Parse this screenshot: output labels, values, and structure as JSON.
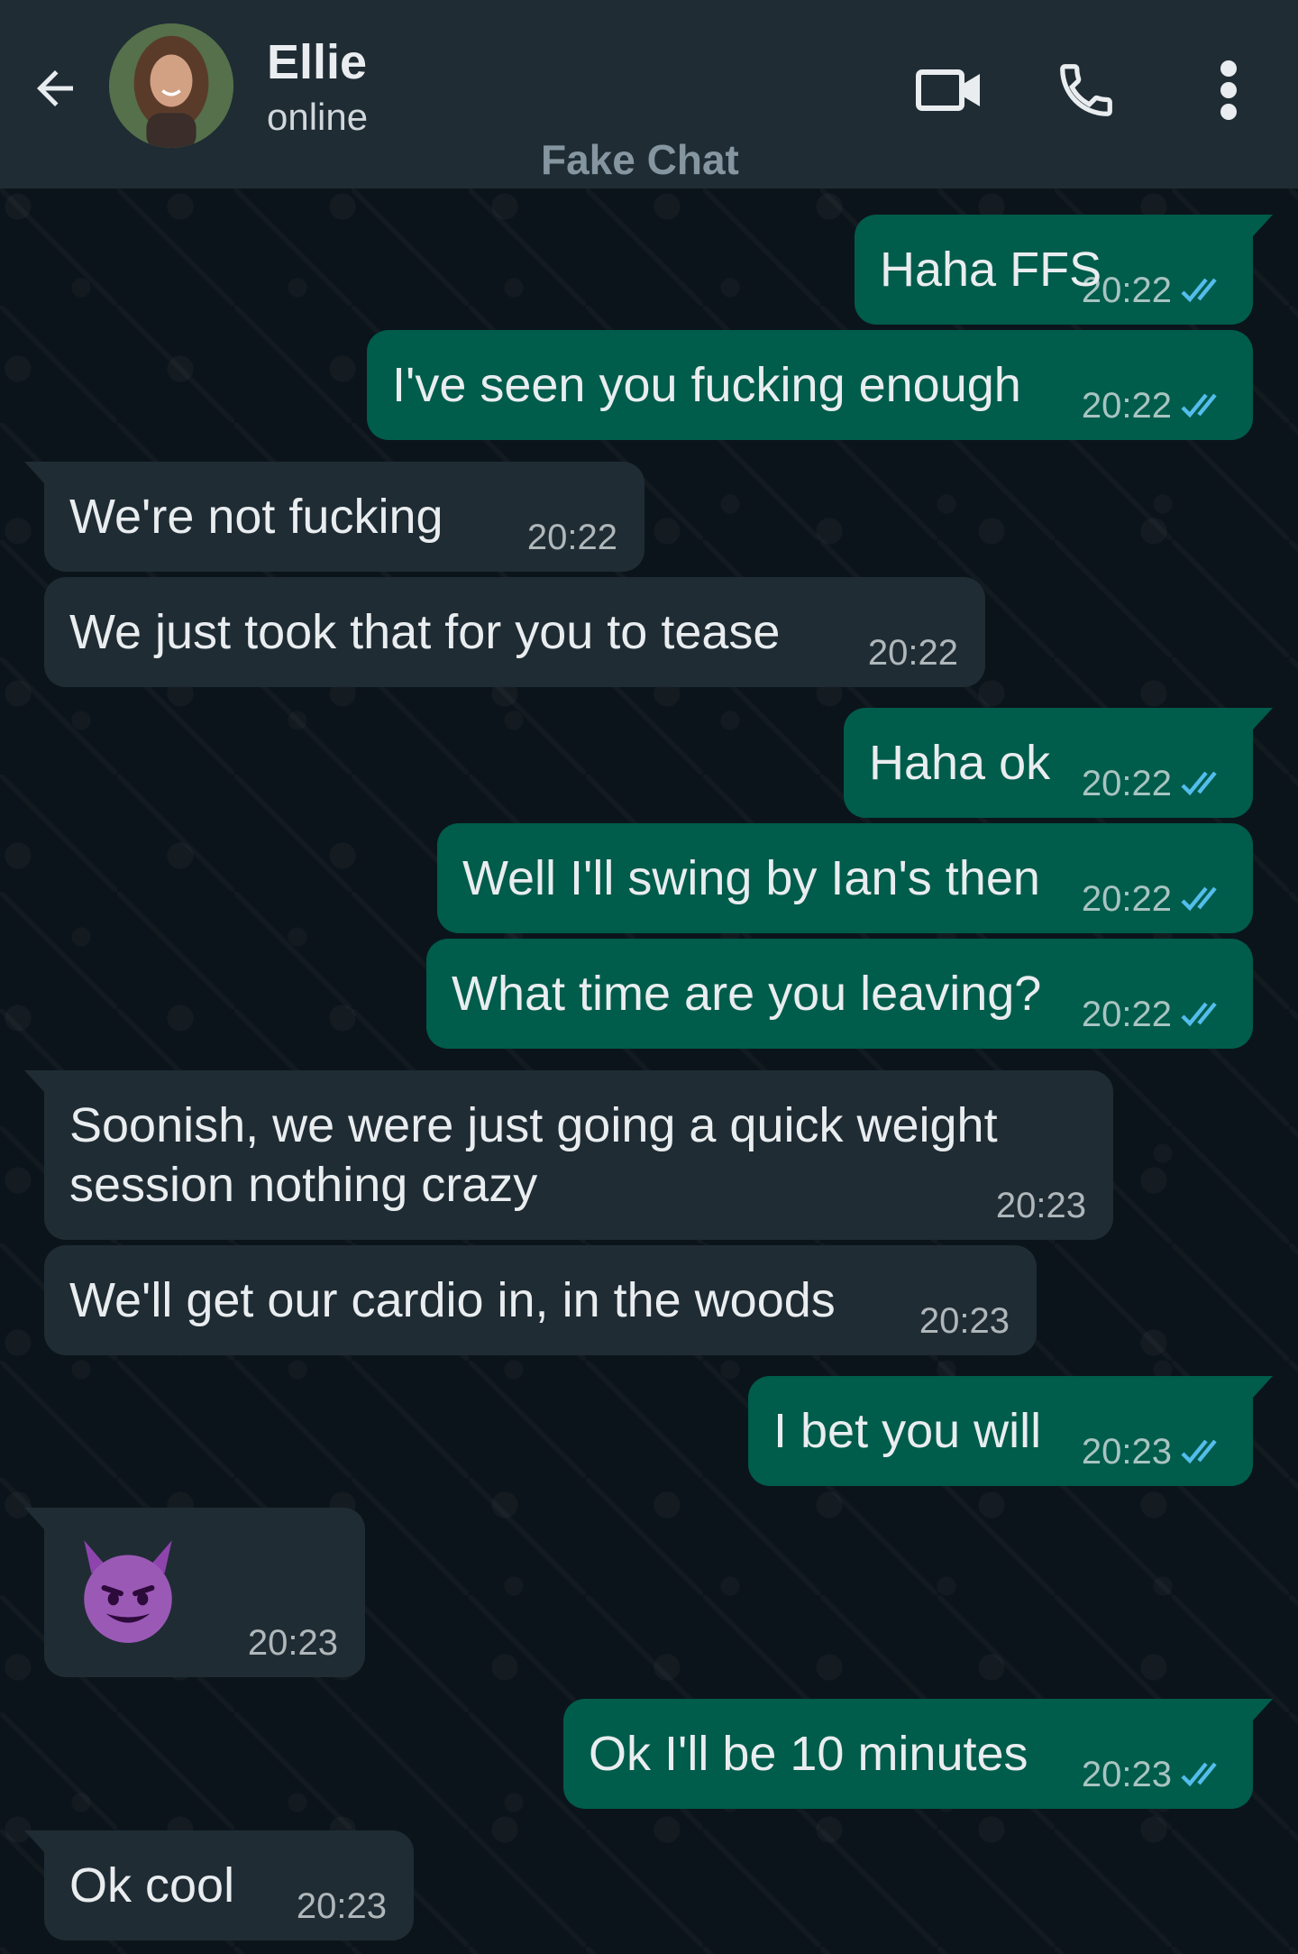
{
  "header": {
    "contact_name": "Ellie",
    "status": "online",
    "watermark": "Fake Chat"
  },
  "icons": {
    "back": "arrow-left-icon",
    "video": "video-camera-icon",
    "call": "phone-icon",
    "menu": "more-vertical-icon",
    "read_receipt": "double-check-icon",
    "emoji": "smiling-imp-emoji"
  },
  "colors": {
    "header_bg": "#1f2c34",
    "chat_bg": "#0b141a",
    "incoming_bubble": "#1f2c34",
    "outgoing_bubble": "#005c4b",
    "read_tick": "#53bdeb"
  },
  "messages": [
    {
      "direction": "out",
      "text": "Haha FFS",
      "time": "20:22",
      "read": true
    },
    {
      "direction": "out",
      "text": "I've seen you fucking enough",
      "time": "20:22",
      "read": true
    },
    {
      "direction": "in",
      "text": "We're not fucking",
      "time": "20:22"
    },
    {
      "direction": "in",
      "text": "We just took that for you to tease",
      "time": "20:22"
    },
    {
      "direction": "out",
      "text": "Haha ok",
      "time": "20:22",
      "read": true
    },
    {
      "direction": "out",
      "text": "Well I'll swing by Ian's then",
      "time": "20:22",
      "read": true
    },
    {
      "direction": "out",
      "text": "What time are you leaving?",
      "time": "20:22",
      "read": true
    },
    {
      "direction": "in",
      "text": "Soonish, we were just going a quick weight session nothing crazy",
      "time": "20:23"
    },
    {
      "direction": "in",
      "text": "We'll get our cardio in, in the woods",
      "time": "20:23"
    },
    {
      "direction": "out",
      "text": "I bet you will",
      "time": "20:23",
      "read": true
    },
    {
      "direction": "in",
      "text": "",
      "emoji": "smiling-imp",
      "time": "20:23"
    },
    {
      "direction": "out",
      "text": "Ok I'll be 10 minutes",
      "time": "20:23",
      "read": true
    },
    {
      "direction": "in",
      "text": "Ok cool",
      "time": "20:23"
    }
  ]
}
